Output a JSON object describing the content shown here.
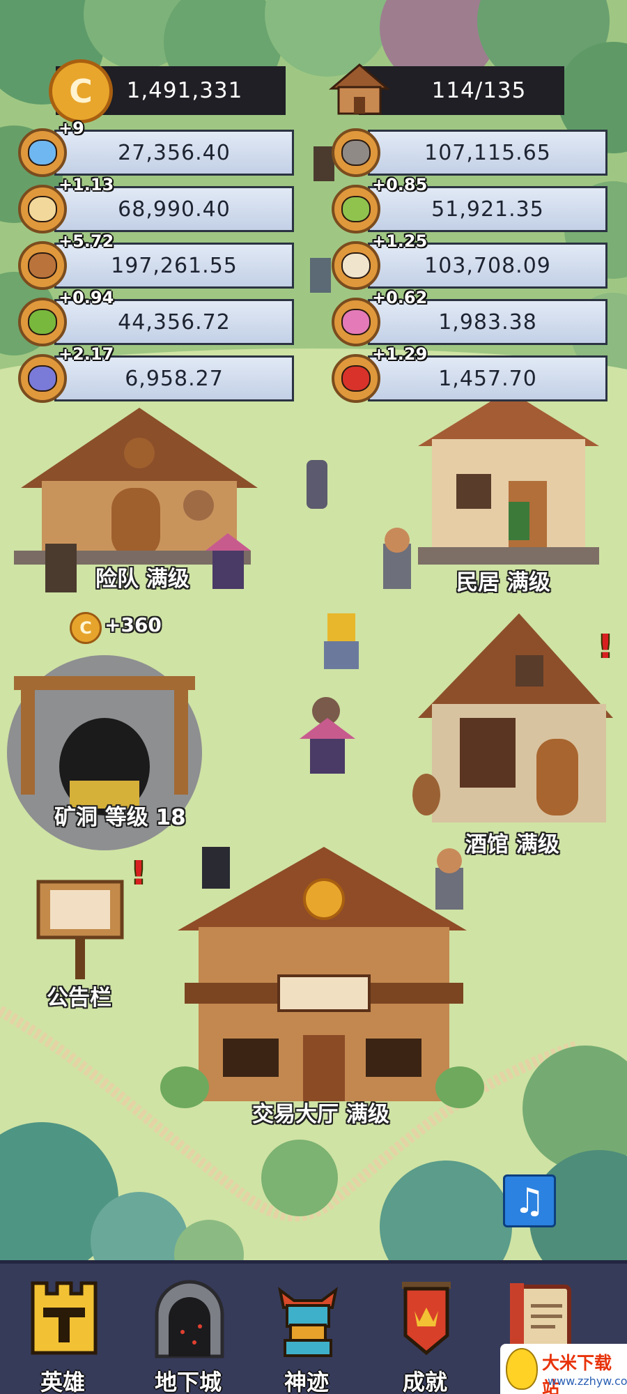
{
  "top": {
    "gold": "1,491,331",
    "gold_icon": "gold-coin-icon",
    "population": "114/135",
    "population_icon": "house-icon"
  },
  "resources": [
    {
      "icon": "slime-icon",
      "color": "#6fb7f0",
      "rate": "+9",
      "value": "27,356.40"
    },
    {
      "icon": "zombie-icon",
      "color": "#8f8a86",
      "rate": "",
      "value": "107,115.65"
    },
    {
      "icon": "skull-icon",
      "color": "#f2d89a",
      "rate": "+1.13",
      "value": "68,990.40"
    },
    {
      "icon": "goblin-icon",
      "color": "#8fc34e",
      "rate": "+0.85",
      "value": "51,921.35"
    },
    {
      "icon": "treant-icon",
      "color": "#b9733b",
      "rate": "+5.72",
      "value": "197,261.55"
    },
    {
      "icon": "wolf-icon",
      "color": "#f0e4cc",
      "rate": "+1.25",
      "value": "103,708.09"
    },
    {
      "icon": "orc-icon",
      "color": "#78b83c",
      "rate": "+0.94",
      "value": "44,356.72"
    },
    {
      "icon": "mushroom-icon",
      "color": "#e47ab8",
      "rate": "+0.62",
      "value": "1,983.38"
    },
    {
      "icon": "imp-icon",
      "color": "#7a7bd8",
      "rate": "+2.17",
      "value": "6,958.27"
    },
    {
      "icon": "demon-icon",
      "color": "#d8322a",
      "rate": "+1.29",
      "value": "1,457.70"
    }
  ],
  "buildings": {
    "adventure_team": "险队  满级",
    "residence": "民居  满级",
    "mine": "矿洞  等级 18",
    "tavern": "酒馆  满级",
    "notice_board": "公告栏",
    "trading_hall": "交易大厅  满级"
  },
  "mine_income": "+360",
  "nav": [
    {
      "label": "英雄",
      "icon": "hero-castle-icon"
    },
    {
      "label": "地下城",
      "icon": "dungeon-portal-icon"
    },
    {
      "label": "神迹",
      "icon": "totem-icon"
    },
    {
      "label": "成就",
      "icon": "achievement-banner-icon"
    },
    {
      "label": "",
      "icon": "scroll-book-icon"
    }
  ],
  "watermark": {
    "title": "大米下载站",
    "url": "www.zzhyw.com"
  },
  "colors": {
    "grass": "#cfe3a4",
    "panel": "#d2dcee",
    "navbar": "#363b5a",
    "coin": "#e8a62c"
  }
}
